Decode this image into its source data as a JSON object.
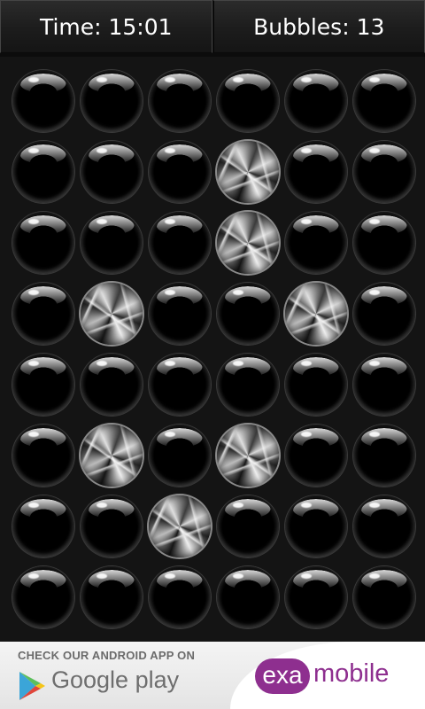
{
  "header": {
    "time_label": "Time: 15:01",
    "bubbles_label": "Bubbles: 13"
  },
  "grid": {
    "columns": 6,
    "rows": 8,
    "cells": [
      [
        "intact",
        "intact",
        "intact",
        "intact",
        "intact",
        "intact"
      ],
      [
        "intact",
        "intact",
        "intact",
        "popped",
        "intact",
        "intact"
      ],
      [
        "intact",
        "intact",
        "intact",
        "popped",
        "intact",
        "intact"
      ],
      [
        "intact",
        "popped",
        "intact",
        "intact",
        "popped",
        "intact"
      ],
      [
        "intact",
        "intact",
        "intact",
        "intact",
        "intact",
        "intact"
      ],
      [
        "intact",
        "popped",
        "intact",
        "popped",
        "intact",
        "intact"
      ],
      [
        "intact",
        "intact",
        "popped",
        "intact",
        "intact",
        "intact"
      ],
      [
        "intact",
        "intact",
        "intact",
        "intact",
        "intact",
        "intact"
      ]
    ]
  },
  "ad": {
    "caption": "CHECK OUR ANDROID APP ON",
    "store_text": "Google play",
    "brand_badge": "exa",
    "brand_text": "mobile",
    "brand_color": "#8e2f8f"
  }
}
